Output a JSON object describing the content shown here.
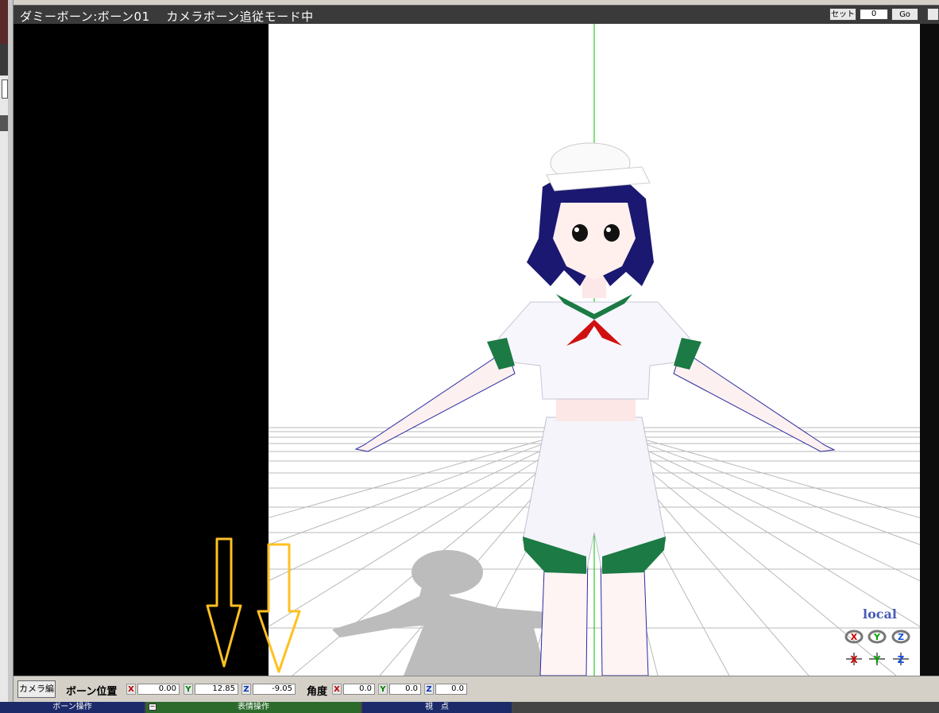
{
  "window": {
    "title": "ダミーボーン:ボーン01　 カメラボーン追従モード中",
    "set_label": "セット",
    "frame_value": "0",
    "go_label": "Go"
  },
  "viewport": {
    "local_label": "local",
    "gizmos": {
      "rotate_x": "x-rotate-icon",
      "rotate_y": "y-rotate-icon",
      "rotate_z": "z-rotate-icon",
      "move_x": "x-move-icon",
      "move_y": "y-move-icon",
      "move_z": "z-move-icon"
    }
  },
  "bone_panel": {
    "camera_edit_label": "カメラ編",
    "position_label": "ボーン位置",
    "angle_label": "角度",
    "axis_x": "X",
    "axis_y": "Y",
    "axis_z": "Z",
    "position": {
      "x": "0.00",
      "y": "12.85",
      "z": "-9.05"
    },
    "angle": {
      "x": "0.0",
      "y": "0.0",
      "z": "0.0"
    }
  },
  "tabs": [
    {
      "label": "ボーン操作"
    },
    {
      "label": "表情操作"
    },
    {
      "label": "視　点"
    }
  ],
  "colors": {
    "title_bg": "#3a3a3a",
    "arrow": "#ffc020",
    "local_label": "#4a5ab8",
    "tab_bone_bg": "#1c2a6a",
    "tab_expression_bg": "#2c6a2c",
    "tab_view_bg": "#1c2a6a"
  }
}
